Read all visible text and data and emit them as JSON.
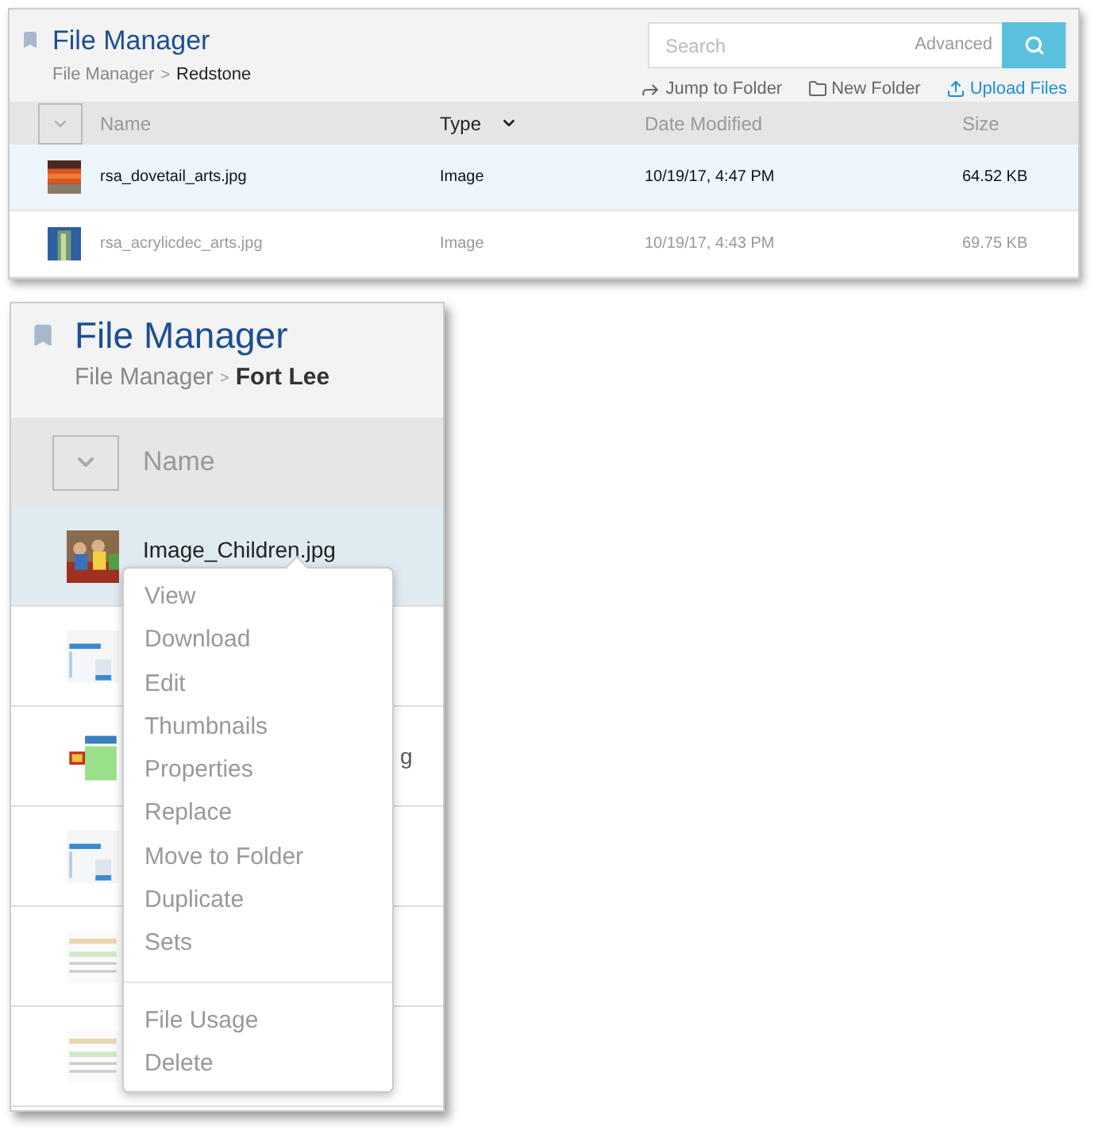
{
  "top_screen": {
    "title": "File Manager",
    "breadcrumb": [
      {
        "label": "File Manager",
        "current": false
      },
      {
        "label": "Redstone",
        "current": true
      }
    ],
    "breadcrumb_separator": ">",
    "search": {
      "placeholder": "Search",
      "advanced": "Advanced"
    },
    "actions": [
      {
        "label": "Jump to Folder",
        "kind": "jump"
      },
      {
        "label": "New Folder",
        "kind": "folder"
      },
      {
        "label": "Upload Files",
        "kind": "upload"
      }
    ],
    "select_all": {
      "checked": false
    },
    "columns": [
      {
        "label": "Name",
        "sorted": false
      },
      {
        "label": "Type",
        "sorted": true
      },
      {
        "label": "Date Modified",
        "sorted": false
      },
      {
        "label": "Size",
        "sorted": false
      }
    ],
    "rows": [
      {
        "name": "rsa_dovetail_arts.jpg",
        "type": "Image",
        "date": "10/19/17, 4:47 PM",
        "size": "64.52 KB",
        "selected": true
      },
      {
        "name": "rsa_acrylicdec_arts.jpg",
        "type": "Image",
        "date": "10/19/17, 4:43 PM",
        "size": "69.75 KB",
        "selected": false
      }
    ]
  },
  "bottom_screen": {
    "title": "File Manager",
    "breadcrumb": [
      {
        "label": "File Manager",
        "current": false
      },
      {
        "label": "Fort Lee",
        "current": true
      }
    ],
    "breadcrumb_separator": ">",
    "select_all": {
      "checked": false
    },
    "columns": [
      {
        "label": "Name"
      }
    ],
    "rows": [
      {
        "name": "Image_Children.jpg",
        "selected": true
      },
      {
        "selected": false
      },
      {
        "name": "g",
        "selected": false
      },
      {
        "selected": false
      },
      {
        "selected": false
      },
      {
        "selected": false
      }
    ],
    "context_menu": {
      "groups": [
        [
          "View",
          "Download",
          "Edit",
          "Thumbnails",
          "Properties",
          "Replace",
          "Move to Folder",
          "Duplicate",
          "Sets"
        ],
        [
          "File Usage",
          "Delete"
        ]
      ]
    }
  }
}
